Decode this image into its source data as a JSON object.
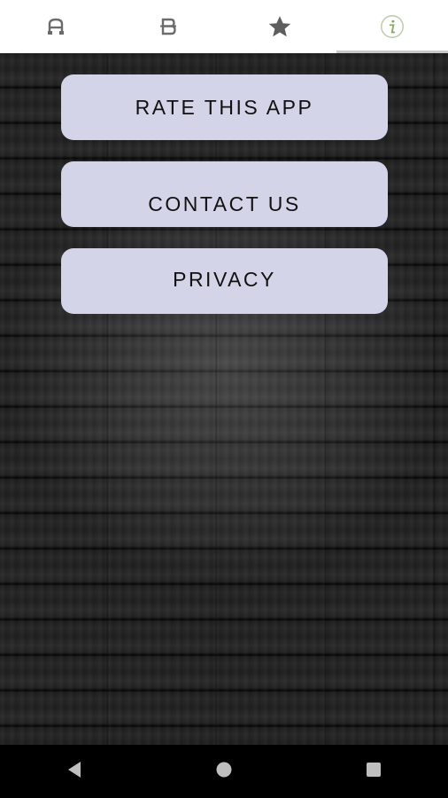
{
  "tabs": [
    {
      "label": "A",
      "icon": "a-car-icon",
      "active": false
    },
    {
      "label": "B",
      "icon": "b-icon",
      "active": false
    },
    {
      "label": "",
      "icon": "star-icon",
      "active": false
    },
    {
      "label": "",
      "icon": "info-icon",
      "active": true
    }
  ],
  "buttons": {
    "rate": "RATE THIS APP",
    "contact": "CONTACT US",
    "privacy": "PRIVACY"
  },
  "navbar": {
    "back": "back-icon",
    "home": "home-icon",
    "recents": "recents-icon"
  },
  "colors": {
    "button_bg": "#d4d4e8",
    "tab_icon": "#6b6b6b",
    "info_icon": "#8aa86a"
  }
}
